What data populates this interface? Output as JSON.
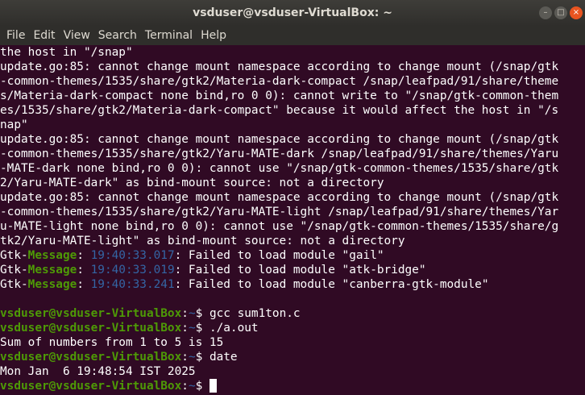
{
  "window": {
    "title": "vsduser@vsduser-VirtualBox: ~",
    "buttons": {
      "minimize": "–",
      "maximize": "□",
      "close": "×"
    }
  },
  "menu": [
    "File",
    "Edit",
    "View",
    "Search",
    "Terminal",
    "Help"
  ],
  "terminal": {
    "colors": {
      "background": "#300a24",
      "text": "#ffffff",
      "prompt_user": "#4e9a06",
      "prompt_path": "#3465a4"
    },
    "output_lines": [
      "the host in \"/snap\"",
      "update.go:85: cannot change mount namespace according to change mount (/snap/gtk",
      "-common-themes/1535/share/gtk2/Materia-dark-compact /snap/leafpad/91/share/theme",
      "s/Materia-dark-compact none bind,ro 0 0): cannot write to \"/snap/gtk-common-them",
      "es/1535/share/gtk2/Materia-dark-compact\" because it would affect the host in \"/s",
      "nap\"",
      "update.go:85: cannot change mount namespace according to change mount (/snap/gtk",
      "-common-themes/1535/share/gtk2/Yaru-MATE-dark /snap/leafpad/91/share/themes/Yaru",
      "-MATE-dark none bind,ro 0 0): cannot use \"/snap/gtk-common-themes/1535/share/gtk",
      "2/Yaru-MATE-dark\" as bind-mount source: not a directory",
      "update.go:85: cannot change mount namespace according to change mount (/snap/gtk",
      "-common-themes/1535/share/gtk2/Yaru-MATE-light /snap/leafpad/91/share/themes/Yar",
      "u-MATE-light none bind,ro 0 0): cannot use \"/snap/gtk-common-themes/1535/share/g",
      "tk2/Yaru-MATE-light\" as bind-mount source: not a directory"
    ],
    "gtk_messages": [
      {
        "prefix": "Gtk-",
        "tag": "Message",
        "time": "19:40:33.017",
        "text": ": Failed to load module \"gail\""
      },
      {
        "prefix": "Gtk-",
        "tag": "Message",
        "time": "19:40:33.019",
        "text": ": Failed to load module \"atk-bridge\""
      },
      {
        "prefix": "Gtk-",
        "tag": "Message",
        "time": "19:40:33.241",
        "text": ": Failed to load module \"canberra-gtk-module\""
      }
    ],
    "gtk_sep": ": ",
    "prompt": {
      "user_host": "vsduser@vsduser-VirtualBox",
      "sep": ":",
      "path": "~",
      "symbol": "$ "
    },
    "session": [
      {
        "command": "gcc sum1ton.c",
        "output": []
      },
      {
        "command": "./a.out",
        "output": [
          "Sum of numbers from 1 to 5 is 15"
        ]
      },
      {
        "command": "date",
        "output": [
          "Mon Jan  6 19:48:54 IST 2025"
        ]
      }
    ]
  }
}
